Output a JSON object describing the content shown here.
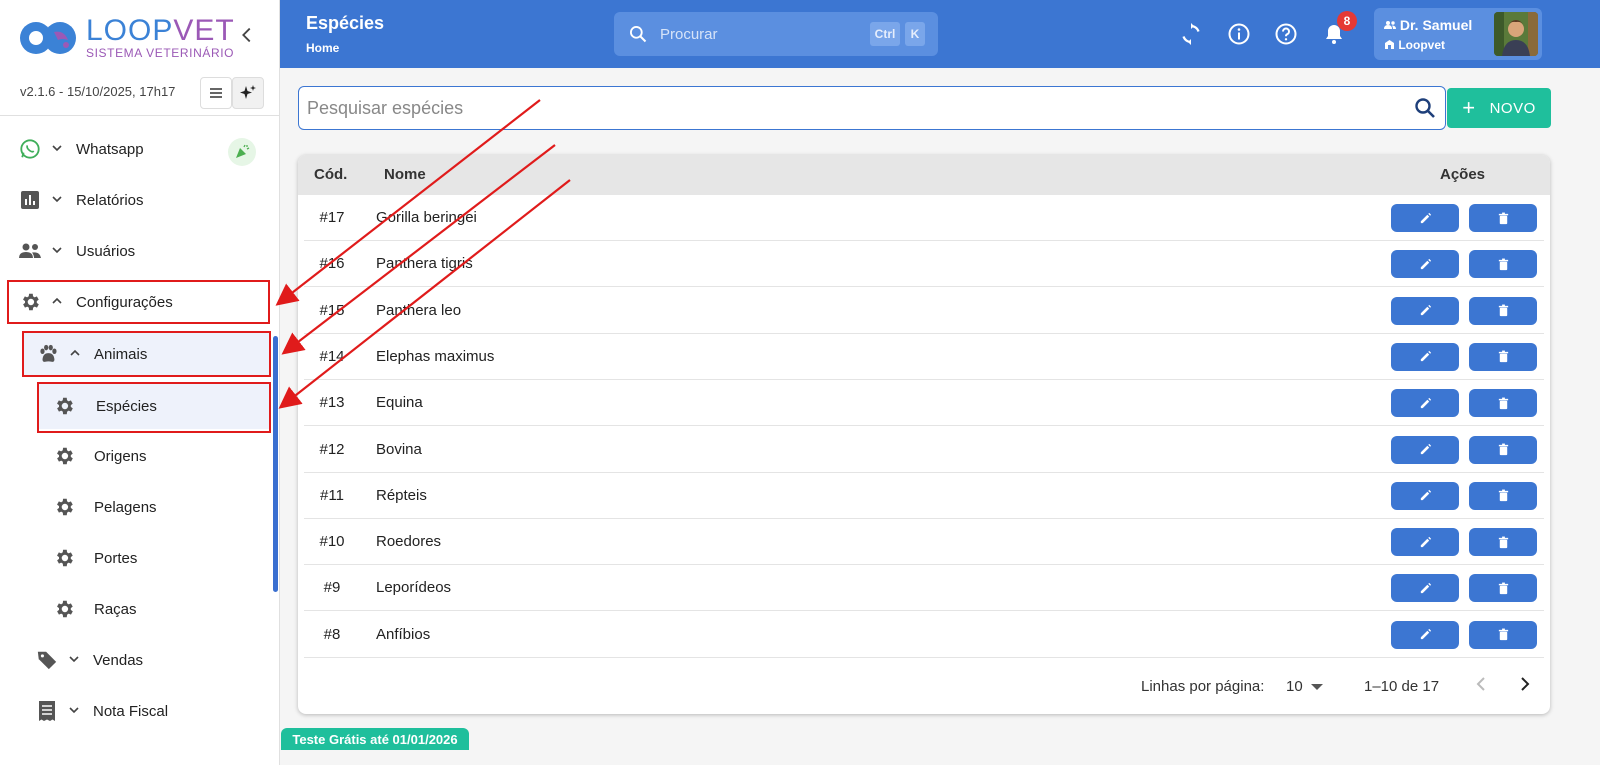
{
  "brand": {
    "name_part1": "LOOP",
    "name_part2": "VET",
    "subtitle": "SISTEMA VETERINÁRIO"
  },
  "version": "v2.1.6 - 15/10/2025, 17h17",
  "sidebar": {
    "items": [
      {
        "label": "Whatsapp",
        "icon": "whatsapp-icon"
      },
      {
        "label": "Relatórios",
        "icon": "bar-chart-icon"
      },
      {
        "label": "Usuários",
        "icon": "users-icon"
      },
      {
        "label": "Configurações",
        "icon": "gear-icon"
      },
      {
        "label": "Animais",
        "icon": "paw-icon"
      },
      {
        "label": "Espécies",
        "icon": "gear-icon"
      },
      {
        "label": "Origens",
        "icon": "gear-icon"
      },
      {
        "label": "Pelagens",
        "icon": "gear-icon"
      },
      {
        "label": "Portes",
        "icon": "gear-icon"
      },
      {
        "label": "Raças",
        "icon": "gear-icon"
      },
      {
        "label": "Vendas",
        "icon": "tag-icon"
      },
      {
        "label": "Nota Fiscal",
        "icon": "receipt-icon"
      }
    ]
  },
  "header": {
    "title": "Espécies",
    "breadcrumb": "Home",
    "search_placeholder": "Procurar",
    "kbd_ctrl": "Ctrl",
    "kbd_k": "K",
    "notification_count": "8",
    "user_name": "Dr. Samuel",
    "user_org": "Loopvet"
  },
  "main": {
    "search_placeholder": "Pesquisar espécies",
    "new_button": "NOVO",
    "table": {
      "columns": [
        "Cód.",
        "Nome",
        "Ações"
      ],
      "rows": [
        {
          "cod": "#17",
          "nome": "Gorilla beringei"
        },
        {
          "cod": "#16",
          "nome": "Panthera tigris"
        },
        {
          "cod": "#15",
          "nome": "Panthera leo"
        },
        {
          "cod": "#14",
          "nome": "Elephas maximus"
        },
        {
          "cod": "#13",
          "nome": "Equina"
        },
        {
          "cod": "#12",
          "nome": "Bovina"
        },
        {
          "cod": "#11",
          "nome": "Répteis"
        },
        {
          "cod": "#10",
          "nome": "Roedores"
        },
        {
          "cod": "#9",
          "nome": "Leporídeos"
        },
        {
          "cod": "#8",
          "nome": "Anfíbios"
        }
      ]
    },
    "pagination": {
      "rows_label": "Linhas por página:",
      "rows_value": "10",
      "range": "1–10 de 17"
    }
  },
  "trial_banner": "Teste Grátis até 01/01/2026",
  "colors": {
    "primary": "#3c76d2",
    "accent": "#1fbf9c",
    "annotation": "#e01b1b",
    "badge": "#e53935"
  }
}
